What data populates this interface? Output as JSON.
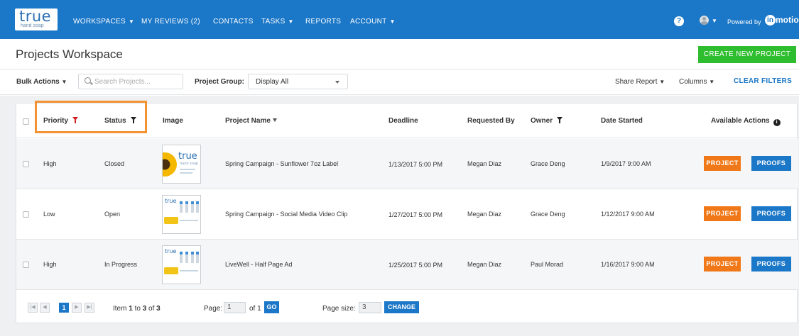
{
  "nav": {
    "logo_main": "true",
    "logo_sub": "hand soap",
    "items": [
      {
        "label": "WORKSPACES",
        "chevron": true
      },
      {
        "label": "MY REVIEWS (2)",
        "chevron": false
      },
      {
        "label": "CONTACTS",
        "chevron": false
      },
      {
        "label": "TASKS",
        "chevron": true
      },
      {
        "label": "REPORTS",
        "chevron": false
      },
      {
        "label": "ACCOUNT",
        "chevron": true
      }
    ],
    "help_icon": "?",
    "powered_by": "Powered by",
    "partner_brand": "motion",
    "partner_mark": "in"
  },
  "header": {
    "title": "Projects Workspace",
    "create_button": "CREATE NEW PROJECT"
  },
  "toolbar": {
    "bulk_actions": "Bulk Actions",
    "search_placeholder": "Search Projects...",
    "project_group_label": "Project Group:",
    "project_group_value": "Display All",
    "share_report": "Share Report",
    "columns": "Columns",
    "clear_filters": "CLEAR FILTERS"
  },
  "grid": {
    "columns": {
      "priority": "Priority",
      "status": "Status",
      "image": "Image",
      "project_name": "Project Name",
      "deadline": "Deadline",
      "requested_by": "Requested By",
      "owner": "Owner",
      "date_started": "Date Started",
      "available_actions": "Available Actions"
    },
    "rows": [
      {
        "priority": "High",
        "status": "Closed",
        "project_name": "Spring Campaign - Sunflower 7oz Label",
        "deadline": "1/13/2017 5:00 PM",
        "requested_by": "Megan Diaz",
        "owner": "Grace Deng",
        "date_started": "1/9/2017 9:00 AM",
        "project_btn": "PROJECT",
        "proofs_btn": "PROOFS"
      },
      {
        "priority": "Low",
        "status": "Open",
        "project_name": "Spring Campaign - Social Media Video Clip",
        "deadline": "1/27/2017 5:00 PM",
        "requested_by": "Megan Diaz",
        "owner": "Grace Deng",
        "date_started": "1/12/2017 9:00 AM",
        "project_btn": "PROJECT",
        "proofs_btn": "PROOFS"
      },
      {
        "priority": "High",
        "status": "In Progress",
        "project_name": "LiveWell - Half Page Ad",
        "deadline": "1/25/2017 5:00 PM",
        "requested_by": "Megan Diaz",
        "owner": "Paul Morad",
        "date_started": "1/16/2017 9:00 AM",
        "project_btn": "PROJECT",
        "proofs_btn": "PROOFS"
      }
    ],
    "thumb_text": "true",
    "thumb_sub": "hand soap"
  },
  "pager": {
    "first": "|◀",
    "prev": "◀",
    "current_page": "1",
    "next": "▶",
    "last": "▶|",
    "item_prefix": "Item",
    "item_from": "1",
    "item_to_word": "to",
    "item_to": "3",
    "item_of_word": "of",
    "item_total": "3",
    "page_label": "Page:",
    "page_value": "1",
    "of_label": "of 1",
    "go": "GO",
    "page_size_label": "Page size:",
    "page_size_value": "3",
    "change": "CHANGE"
  },
  "colors": {
    "nav_blue": "#1b77c7",
    "create_green": "#2ebd2e",
    "project_orange": "#f07818",
    "filter_red": "#d32027",
    "highlight_orange": "#f39233"
  }
}
